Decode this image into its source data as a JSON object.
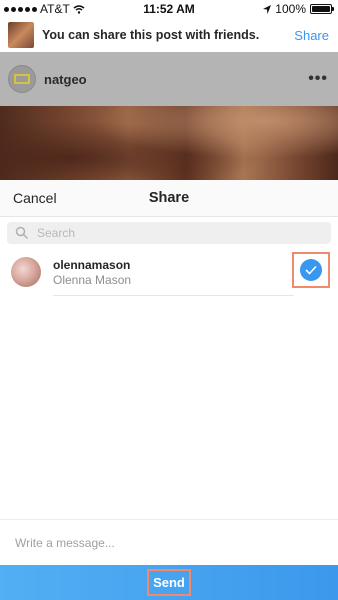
{
  "status_bar": {
    "carrier": "AT&T",
    "time": "11:52 AM",
    "battery": "100%",
    "battery_level": 1.0
  },
  "notice": {
    "text": "You can share this post with friends.",
    "share_label": "Share"
  },
  "post": {
    "username": "natgeo",
    "more_label": "•••"
  },
  "share_sheet": {
    "cancel_label": "Cancel",
    "title": "Share",
    "search_placeholder": "Search",
    "contacts": [
      {
        "username": "olennamason",
        "full_name": "Olenna Mason",
        "selected": true
      }
    ],
    "message_placeholder": "Write a message...",
    "send_label": "Send"
  },
  "colors": {
    "accent": "#3897f0",
    "highlight_outline": "#f08a6a"
  }
}
